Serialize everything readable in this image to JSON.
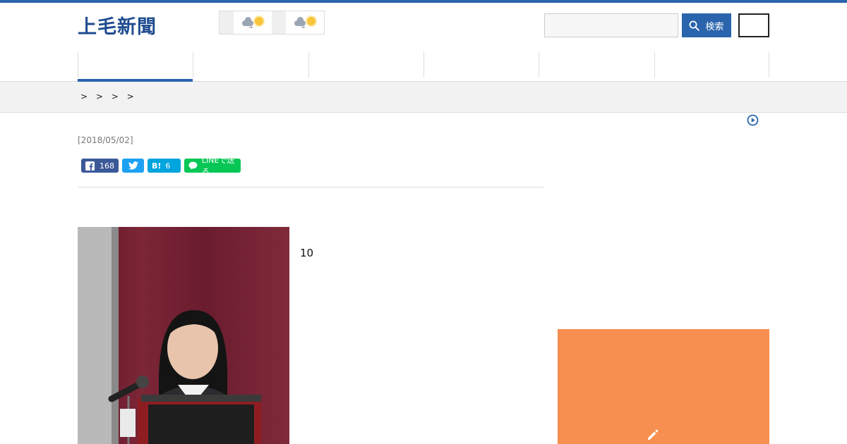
{
  "brand": {
    "name": "上毛新聞",
    "accent": "#2a64ac",
    "ad_color": "#f68f4f"
  },
  "weather": {
    "icons": [
      "cloudy-then-sunny-icon",
      "cloudy-then-sunny-icon"
    ]
  },
  "search": {
    "placeholder": "",
    "button_label": "検索"
  },
  "nav": {
    "items": [
      {
        "label": "",
        "active": true
      },
      {
        "label": ""
      },
      {
        "label": ""
      },
      {
        "label": ""
      },
      {
        "label": ""
      },
      {
        "label": ""
      }
    ]
  },
  "breadcrumb": {
    "items": [
      "",
      "",
      "",
      ""
    ],
    "current": ""
  },
  "article": {
    "title": "",
    "date": "[2018/05/02]",
    "share": {
      "facebook_count": "168",
      "hatena_label": "B!",
      "hatena_count": "6",
      "line_label": "LINEで送る"
    },
    "paragraphs": [
      "",
      "",
      "",
      "10"
    ]
  }
}
